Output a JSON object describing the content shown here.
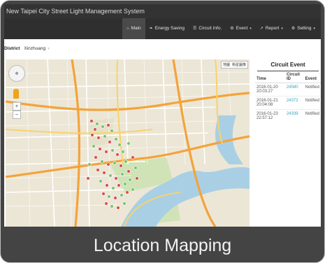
{
  "app_title": "New Taipei City Street Light Management System",
  "nav": [
    {
      "label": "Main",
      "icon": "home-icon",
      "glyph": "⌂",
      "dropdown": false,
      "active": true
    },
    {
      "label": "Energy Saving",
      "icon": "leaf-icon",
      "glyph": "❧",
      "dropdown": false,
      "active": false
    },
    {
      "label": "Circuit Info.",
      "icon": "list-icon",
      "glyph": "☰",
      "dropdown": false,
      "active": false
    },
    {
      "label": "Event",
      "icon": "cogs-icon",
      "glyph": "⚙",
      "dropdown": true,
      "active": false
    },
    {
      "label": "Report",
      "icon": "chart-icon",
      "glyph": "↗",
      "dropdown": true,
      "active": false
    },
    {
      "label": "Setting",
      "icon": "gear-icon",
      "glyph": "⚙",
      "dropdown": true,
      "active": false
    }
  ],
  "district": {
    "label": "District",
    "value": "Xinzhuang"
  },
  "map": {
    "type_buttons": [
      "地圖",
      "衛星圖像"
    ]
  },
  "circuit_event": {
    "title": "Circuit Event",
    "columns": [
      "Time",
      "Circuit ID",
      "Event"
    ],
    "rows": [
      {
        "time": "2016-01-20 20:03:27",
        "circuit_id": "24580",
        "event": "Notified"
      },
      {
        "time": "2016-01-21 20:04:08",
        "circuit_id": "24372",
        "event": "Notified"
      },
      {
        "time": "2016-01-23 22:57:12",
        "circuit_id": "24339",
        "event": "Notified"
      }
    ]
  },
  "caption": "Location Mapping",
  "colors": {
    "marker_red": "#d9534f",
    "marker_green": "#7dc474",
    "river": "#a9cfe5",
    "park": "#cfe3b6",
    "road": "#f4a33a"
  }
}
